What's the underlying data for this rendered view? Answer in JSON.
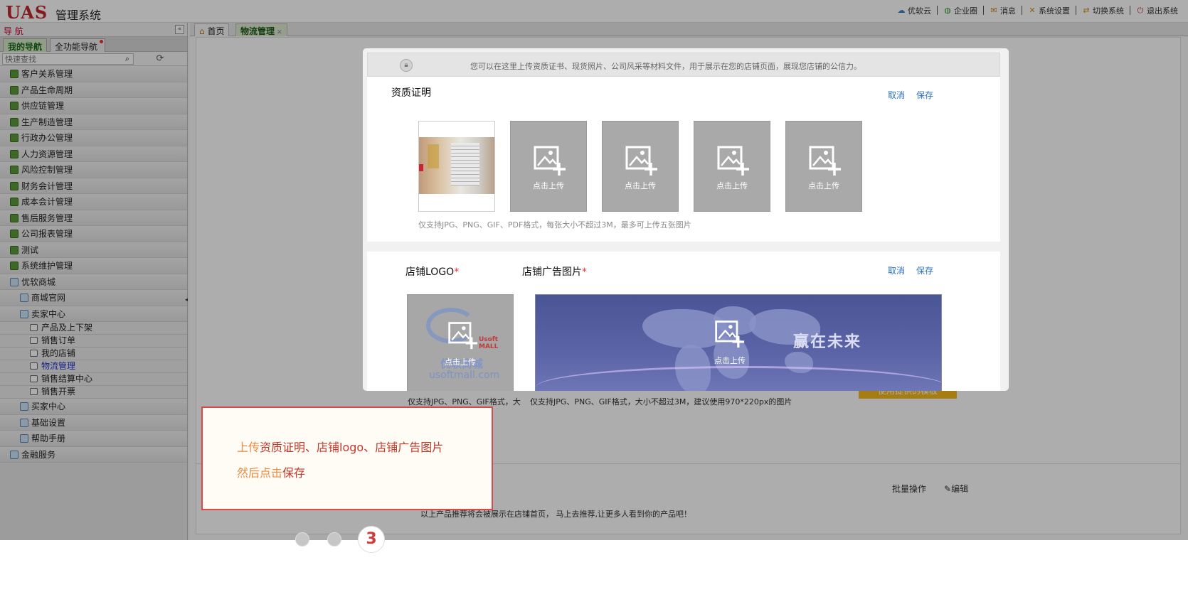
{
  "app": {
    "logo": "UAS",
    "title": "管理系统"
  },
  "topnav": [
    {
      "label": "优软云",
      "icon": "cloud-icon",
      "color": "#3a7fc6"
    },
    {
      "label": "企业圈",
      "icon": "globe-icon",
      "color": "#3a9a3a"
    },
    {
      "label": "消息",
      "icon": "message-icon",
      "color": "#d08a1a"
    },
    {
      "label": "系统设置",
      "icon": "tools-icon",
      "color": "#d08a1a"
    },
    {
      "label": "切换系统",
      "icon": "switch-icon",
      "color": "#d08a1a"
    },
    {
      "label": "退出系统",
      "icon": "power-icon",
      "color": "#c03030"
    }
  ],
  "sidebar": {
    "header": "导 航",
    "tabs": [
      "我的导航",
      "全功能导航"
    ],
    "search_placeholder": "快速查找",
    "items": [
      {
        "label": "客户关系管理",
        "type": "book",
        "level": 0
      },
      {
        "label": "产品生命周期",
        "type": "book",
        "level": 0
      },
      {
        "label": "供应链管理",
        "type": "book",
        "level": 0
      },
      {
        "label": "生产制造管理",
        "type": "book",
        "level": 0
      },
      {
        "label": "行政办公管理",
        "type": "book",
        "level": 0
      },
      {
        "label": "人力资源管理",
        "type": "book",
        "level": 0
      },
      {
        "label": "风险控制管理",
        "type": "book",
        "level": 0
      },
      {
        "label": "财务会计管理",
        "type": "book",
        "level": 0
      },
      {
        "label": "成本会计管理",
        "type": "book",
        "level": 0
      },
      {
        "label": "售后服务管理",
        "type": "book",
        "level": 0
      },
      {
        "label": "公司报表管理",
        "type": "book",
        "level": 0
      },
      {
        "label": "测试",
        "type": "book",
        "level": 0
      },
      {
        "label": "系统维护管理",
        "type": "book",
        "level": 0
      },
      {
        "label": "优软商城",
        "type": "folder",
        "level": 0
      },
      {
        "label": "商城官网",
        "type": "folder",
        "level": 1
      },
      {
        "label": "卖家中心",
        "type": "folder",
        "level": 1
      },
      {
        "label": "产品及上下架",
        "type": "doc",
        "level": 2
      },
      {
        "label": "销售订单",
        "type": "doc",
        "level": 2
      },
      {
        "label": "我的店铺",
        "type": "doc",
        "level": 2
      },
      {
        "label": "物流管理",
        "type": "doc",
        "level": 2,
        "selected": true
      },
      {
        "label": "销售结算中心",
        "type": "doc",
        "level": 2
      },
      {
        "label": "销售开票",
        "type": "doc",
        "level": 2
      },
      {
        "label": "买家中心",
        "type": "folder",
        "level": 1
      },
      {
        "label": "基础设置",
        "type": "folder",
        "level": 1
      },
      {
        "label": "帮助手册",
        "type": "folder",
        "level": 1
      },
      {
        "label": "金融服务",
        "type": "folder",
        "level": 0
      }
    ]
  },
  "tabs": [
    {
      "label": "首页",
      "icon": "home-icon"
    },
    {
      "label": "物流管理",
      "active": true
    }
  ],
  "background": {
    "logo_note": "仅支持JPG、PNG、GIF格式，大",
    "ad_note": "仅支持JPG、PNG、GIF格式，大小不超过3M，建议使用970*220px的图片",
    "template_button": "使用提供的模板",
    "batch_label": "批量操作",
    "edit_label": "编辑",
    "recommend_text": "以上产品推荐将会被展示在店铺首页， 马上去推荐,让更多人看到你的产品吧！"
  },
  "dialog": {
    "notice": "您可以在这里上传资质证书、现货照片、公司风采等材料文件，用于展示在您的店铺页面，展现您店铺的公信力。",
    "cert": {
      "title": "资质证明",
      "cancel": "取消",
      "save": "保存",
      "upload_label": "点击上传",
      "note": "仅支持JPG、PNG、GIF、PDF格式，每张大小不超过3M，最多可上传五张图片"
    },
    "logo": {
      "title": "店铺LOGO",
      "required": "*",
      "brand_cn": "优软商城",
      "brand_url": "usoftmall.com",
      "brand_tag": "Usoft MALL",
      "upload_label": "点击上传"
    },
    "ad": {
      "title": "店铺广告图片",
      "required": "*",
      "cancel": "取消",
      "save": "保存",
      "slogan": "赢在未来",
      "upload_label": "点击上传"
    }
  },
  "callout": {
    "line1_pre": "上传",
    "line1_rest": "资质证明、店铺logo、店铺广告图片",
    "line2_pre": "然后点击",
    "line2_rest": "保存"
  },
  "pager": {
    "current_step": "3",
    "total_steps": 3
  }
}
